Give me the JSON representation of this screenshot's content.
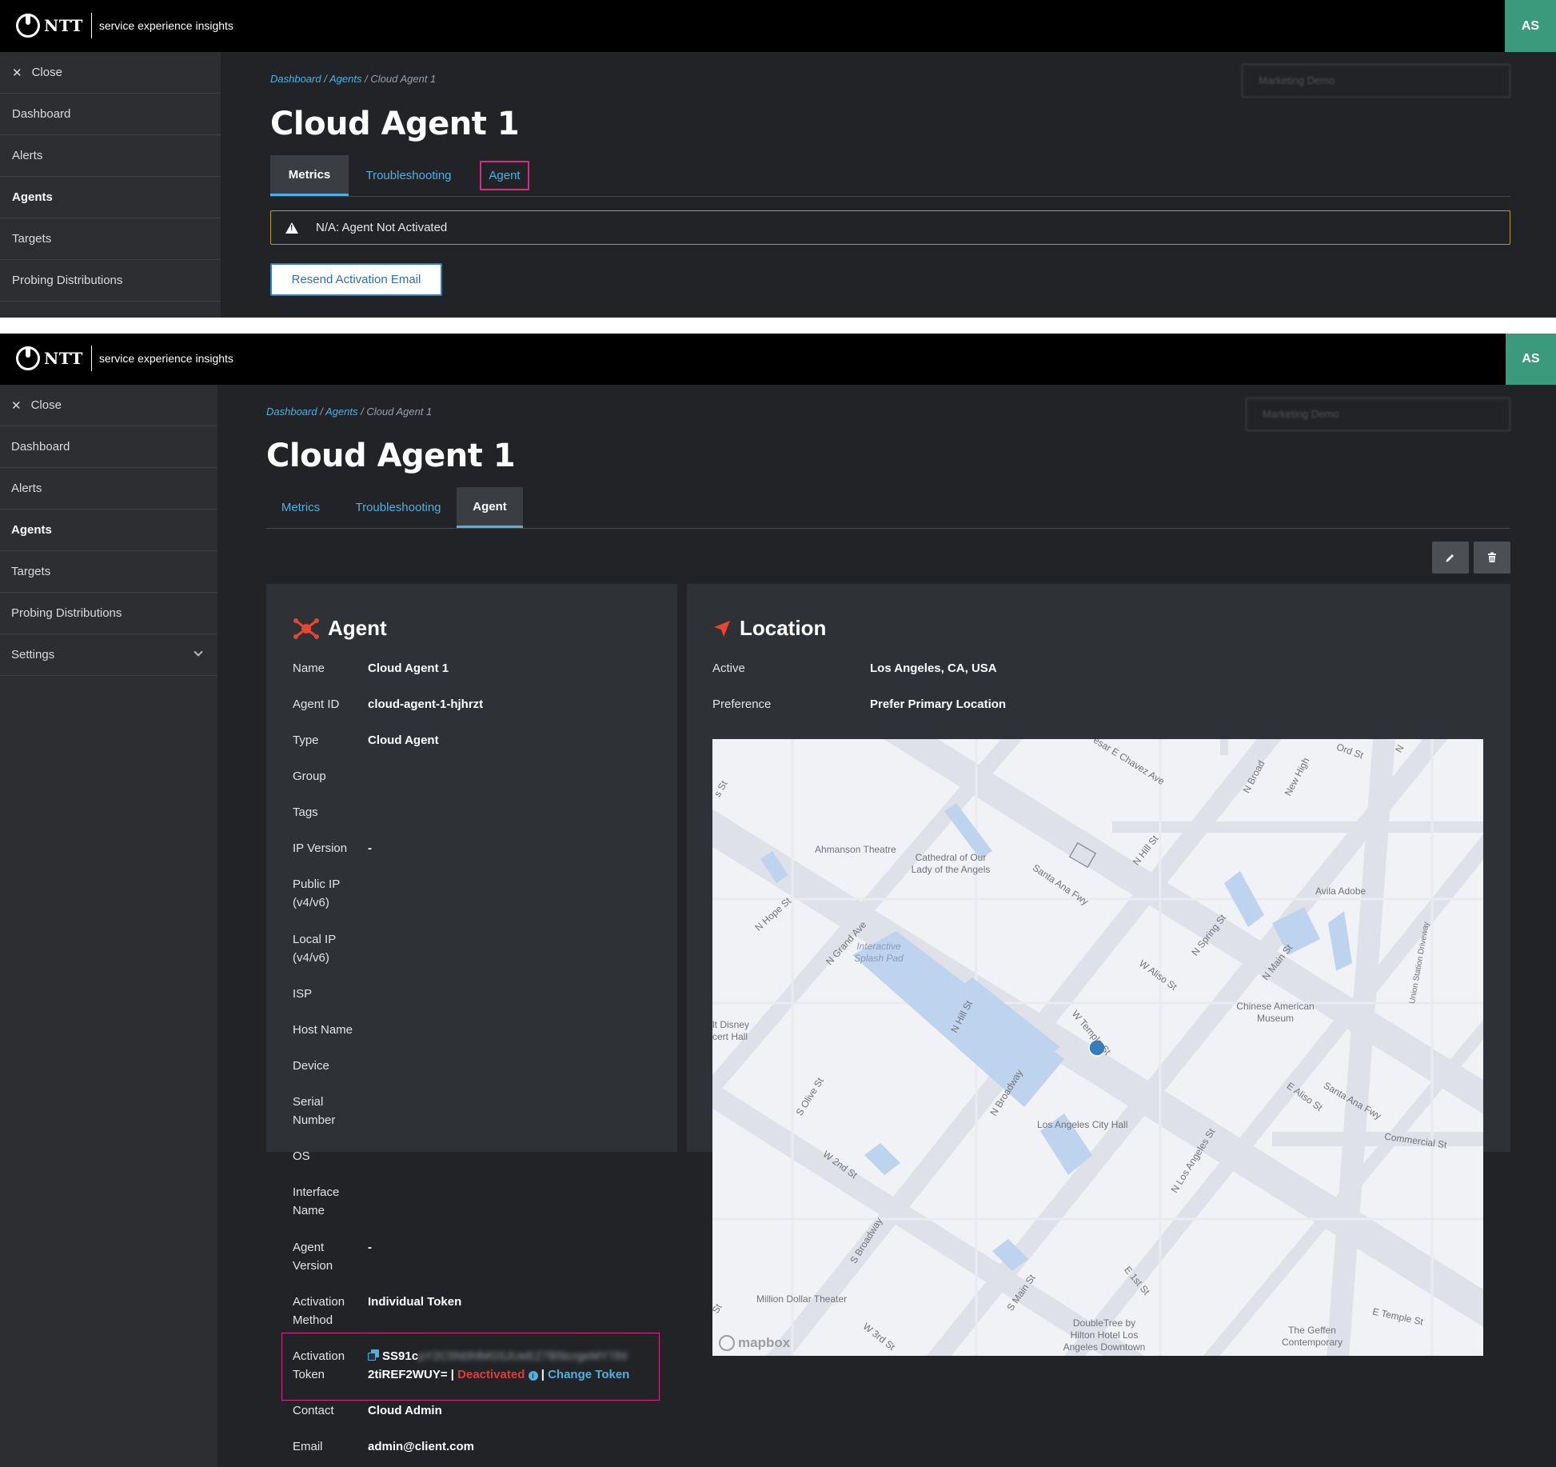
{
  "header": {
    "brand": "NTT",
    "subtitle": "service experience insights",
    "avatar_initials": "AS"
  },
  "sidebar": {
    "close_label": "Close",
    "items": [
      {
        "label": "Dashboard"
      },
      {
        "label": "Alerts"
      },
      {
        "label": "Agents"
      },
      {
        "label": "Targets"
      },
      {
        "label": "Probing Distributions"
      },
      {
        "label": "Settings"
      }
    ]
  },
  "breadcrumb": {
    "dashboard": "Dashboard",
    "agents": "Agents",
    "current": "Cloud Agent 1",
    "sep": "/"
  },
  "org_selector": {
    "placeholder": "Marketing Demo"
  },
  "page": {
    "title": "Cloud Agent 1"
  },
  "tabs": {
    "metrics": "Metrics",
    "troubleshooting": "Troubleshooting",
    "agent": "Agent"
  },
  "alert": {
    "text": "N/A: Agent Not Activated"
  },
  "resend_button": {
    "label": "Resend Activation Email"
  },
  "agent_card": {
    "title": "Agent",
    "fields": {
      "name": {
        "label": "Name",
        "value": "Cloud Agent 1"
      },
      "agent_id": {
        "label": "Agent ID",
        "value": "cloud-agent-1-hjhrzt"
      },
      "type": {
        "label": "Type",
        "value": "Cloud Agent"
      },
      "group": {
        "label": "Group",
        "value": ""
      },
      "tags": {
        "label": "Tags",
        "value": ""
      },
      "ip_version": {
        "label": "IP Version",
        "value": "-"
      },
      "public_ip": {
        "label": "Public IP (v4/v6)",
        "value": ""
      },
      "local_ip": {
        "label": "Local IP (v4/v6)",
        "value": ""
      },
      "isp": {
        "label": "ISP",
        "value": ""
      },
      "host_name": {
        "label": "Host Name",
        "value": ""
      },
      "device": {
        "label": "Device",
        "value": ""
      },
      "serial_number": {
        "label": "Serial Number",
        "value": ""
      },
      "os": {
        "label": "OS",
        "value": ""
      },
      "interface_name": {
        "label": "Interface Name",
        "value": ""
      },
      "agent_version": {
        "label": "Agent Version",
        "value": "-"
      },
      "activation_method": {
        "label": "Activation Method",
        "value": "Individual Token"
      },
      "activation_token": {
        "label": "Activation Token",
        "value_start": "SS91c",
        "value_hidden": "pY2C5N0hlMG5JUeEZ7B5tcrgeMY7ihbWB",
        "value_end": "2tiREF2WUY=",
        "pipe": "|",
        "status": "Deactivated",
        "change_link": "Change Token"
      },
      "contact": {
        "label": "Contact",
        "value": "Cloud Admin"
      },
      "email": {
        "label": "Email",
        "value": "admin@client.com"
      }
    }
  },
  "location_card": {
    "title": "Location",
    "active": {
      "label": "Active",
      "value": "Los Angeles, CA, USA"
    },
    "preference": {
      "label": "Preference",
      "value": "Prefer Primary Location"
    }
  },
  "map": {
    "attribution": "mapbox",
    "labels": {
      "ahmanson": "Ahmanson Theatre",
      "cathedral": "Cathedral of Our Lady of the Angels",
      "splash": "Interactive Splash Pad",
      "disney": "lt Disney cert Hall",
      "avila": "Avila Adobe",
      "chinese": "Chinese American Museum",
      "city_hall": "Los Angeles City Hall",
      "million": "Million Dollar Theater",
      "doubletree": "DoubleTree by Hilton Hotel Los Angeles Downtown",
      "geffen": "The Geffen Contemporary",
      "union": "Union Station Driveway",
      "s_hope": "N Hope St",
      "n_grand": "N Grand Ave",
      "n_hill": "N Hill St",
      "n_hill2": "N Hill St",
      "santa_ana": "Santa Ana Fwy",
      "santa_ana2": "Santa Ana Fwy",
      "cesar": "esar E Chavez Ave",
      "n_broad": "N Broad",
      "new_high": "New High",
      "ord": "Ord St",
      "n_spring": "N Spring St",
      "n_main": "N Main St",
      "w_aliso": "W Aliso St",
      "e_aliso": "E Aliso St",
      "w_temple": "W Temple St",
      "n_broadway": "N Broadway",
      "s_olive": "S Olive St",
      "w_2nd": "W 2nd St",
      "s_broadway": "S Broadway",
      "s_main": "S Main St",
      "e_1st": "E 1st St",
      "w_3rd": "W 3rd St",
      "e_temple": "E Temple St",
      "commercial": "Commercial St",
      "n_la": "N Los Angeles St",
      "s_st": "s St",
      "st": "St",
      "n": "N"
    }
  }
}
